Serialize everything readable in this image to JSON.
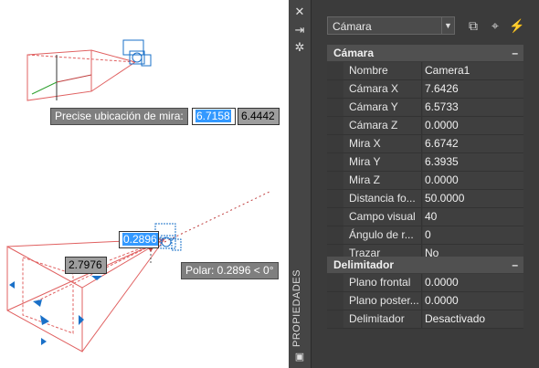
{
  "drawing": {
    "tooltip_target_label": "Precise ubicación de mira:",
    "tooltip_target_x": "6.7158",
    "tooltip_target_y": "6.4442",
    "dim_value_1": "0.2896",
    "dim_value_2": "2.7976",
    "polar_tooltip": "Polar: 0.2896 < 0°"
  },
  "palette": {
    "title_vertical": "PROPIEDADES",
    "object_selector": "Cámara",
    "categories": [
      {
        "title": "Cámara",
        "collapse_symbol": "–",
        "rows": [
          {
            "label": "Nombre",
            "value": "Camera1"
          },
          {
            "label": "Cámara X",
            "value": "7.6426"
          },
          {
            "label": "Cámara Y",
            "value": "6.5733"
          },
          {
            "label": "Cámara Z",
            "value": "0.0000"
          },
          {
            "label": "Mira X",
            "value": "6.6742"
          },
          {
            "label": "Mira Y",
            "value": "6.3935"
          },
          {
            "label": "Mira Z",
            "value": "0.0000"
          },
          {
            "label": "Distancia fo...",
            "value": "50.0000"
          },
          {
            "label": "Campo visual",
            "value": "40"
          },
          {
            "label": "Ángulo de r...",
            "value": "0"
          },
          {
            "label": "Trazar",
            "value": "No"
          }
        ]
      },
      {
        "title": "Delimitador",
        "collapse_symbol": "–",
        "rows": [
          {
            "label": "Plano frontal",
            "value": "0.0000"
          },
          {
            "label": "Plano poster...",
            "value": "0.0000"
          },
          {
            "label": "Delimitador",
            "value": "Desactivado"
          }
        ]
      }
    ]
  },
  "colors": {
    "accent": "#3399ff",
    "palette_bg": "#3b3b3b",
    "frustum": "#e06060",
    "camera": "#1a70c8"
  }
}
